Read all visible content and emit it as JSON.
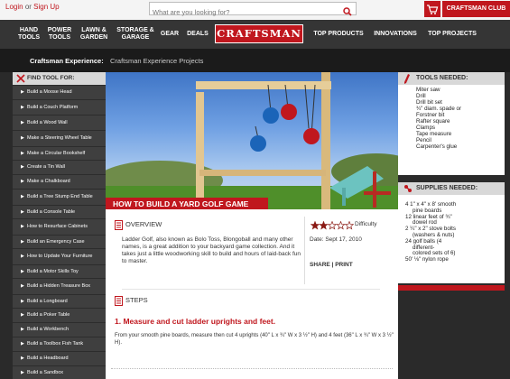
{
  "header": {
    "login": "Login",
    "or": "or",
    "signup": "Sign Up",
    "search_placeholder": "What are you looking for?",
    "club": "CRAFTSMAN CLUB",
    "icons": {
      "search": "search-icon",
      "cart": "cart-icon"
    }
  },
  "nav": {
    "items": [
      "HAND TOOLS",
      "POWER TOOLS",
      "LAWN & GARDEN",
      "STORAGE & GARAGE",
      "GEAR",
      "DEALS"
    ],
    "logo": "CRAFTSMAN",
    "right_items": [
      "TOP PRODUCTS",
      "INNOVATIONS",
      "TOP PROJECTS"
    ]
  },
  "breadcrumb": {
    "title": "Craftsman Experience:",
    "link": "Craftsman Experience Projects"
  },
  "sidebar": {
    "heading": "FIND TOOL FOR:",
    "items": [
      "Build a Moose Head",
      "Build a Couch Platform",
      "Build a Wood Wall",
      "Make a Steering Wheel Table",
      "Make a Circular Bookshelf",
      "Create a Tin Wall",
      "Make a Chalkboard",
      "Build a Tree Stump End Table",
      "Build a Console Table",
      "How to Resurface Cabinets",
      "Build an Emergency Case",
      "How to Update Your Furniture",
      "Build a Motor Skills Toy",
      "Build a Hidden Treasure Box",
      "Build a Longboard",
      "Build a Poker Table",
      "Build a Workbench",
      "Build a Toolbox Fish Tank",
      "Build a Headboard",
      "Build a Sandbox"
    ]
  },
  "hero": {
    "title": "HOW TO BUILD A YARD GOLF GAME",
    "colors": {
      "red_ball": "#c0171e",
      "blue_ball": "#1b64b8"
    }
  },
  "overview": {
    "label": "OVERVIEW",
    "text": "Ladder Golf, also known as Bolo Toss, Blongoball and many other names, is a great addition to your backyard game collection. And it takes just a little woodworking skill to build and hours of laid-back fun to master.",
    "difficulty_label": "Difficulty",
    "difficulty_rating": 2,
    "difficulty_max": 5,
    "date": "Date: Sept 17, 2010",
    "share": "SHARE",
    "print": "PRINT"
  },
  "steps": {
    "label": "STEPS",
    "step1_title": "1. Measure and cut ladder uprights and feet.",
    "step1_text": "From your smooth pine boards, measure then cut 4 uprights (40\" L x ¾\" W x 3 ½\" H) and 4 feet (36\" L x ¾\" W x 3 ½\" H)."
  },
  "tools": {
    "heading": "TOOLS NEEDED:",
    "items": [
      "Miter saw",
      "Drill",
      "Drill bit set",
      "¾\" diam. spade or",
      "Forstner bit",
      "Rafter square",
      "Clamps",
      "Tape measure",
      "Pencil",
      "Carpenter's glue"
    ]
  },
  "supplies": {
    "heading": "SUPPLIES NEEDED:",
    "items": [
      "4 1\" x 4\" x 8' smooth",
      "pine boards",
      "12 linear feet of ¾\"",
      "dowel rod",
      "2 ¼\" x 2\" stove bolts",
      "(washers & nuts)",
      "24 golf balls (4",
      "different-",
      "colored sets of 6)",
      "50' ⅛\" nylon rope"
    ]
  },
  "colors": {
    "accent": "#c0171e",
    "nav_bg": "#353535"
  }
}
